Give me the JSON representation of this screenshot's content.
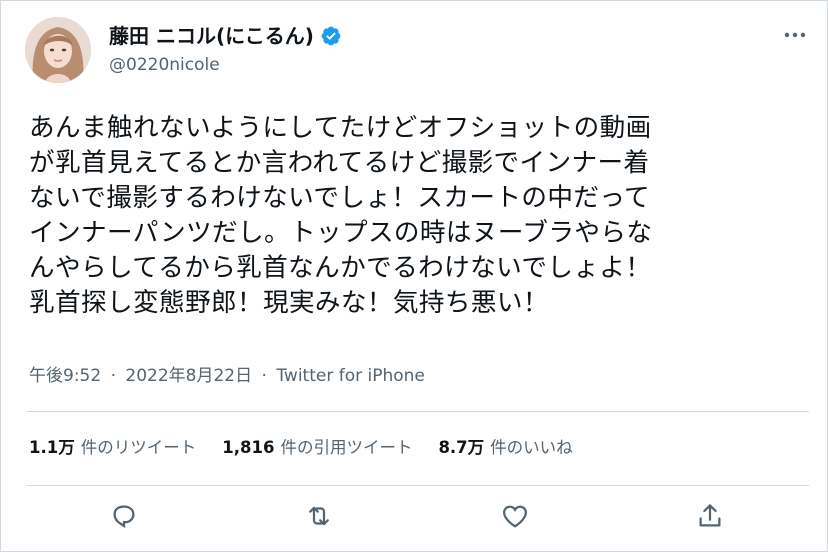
{
  "author": {
    "display_name": "藤田 ニコル(にこるん)",
    "handle": "@0220nicole",
    "verified": true,
    "accent_color": "#1d9bf0"
  },
  "tweet": {
    "lines": [
      "あんま触れないようにしてたけどオフショットの動画",
      "が乳首見えてるとか言われてるけど撮影でインナー着",
      "ないで撮影するわけないでしょ！スカートの中だって",
      "インナーパンツだし。トップスの時はヌーブラやらな",
      "んやらしてるから乳首なんかでるわけないでしょよ！",
      "乳首探し変態野郎！現実みな！気持ち悪い！"
    ]
  },
  "meta": {
    "time": "午後9:52",
    "separator": "·",
    "date": "2022年8月22日",
    "source": "Twitter for iPhone"
  },
  "stats": [
    {
      "count": "1.1万",
      "label": "件のリツイート"
    },
    {
      "count": "1,816",
      "label": "件の引用ツイート"
    },
    {
      "count": "8.7万",
      "label": "件のいいね"
    }
  ],
  "icons": {
    "more": "more-horizontal-icon",
    "reply": "reply-icon",
    "retweet": "retweet-icon",
    "like": "heart-icon",
    "share": "share-icon",
    "verified": "verified-badge-icon"
  },
  "colors": {
    "text": "#0f1419",
    "secondary": "#536471",
    "divider": "#cfd9de"
  }
}
